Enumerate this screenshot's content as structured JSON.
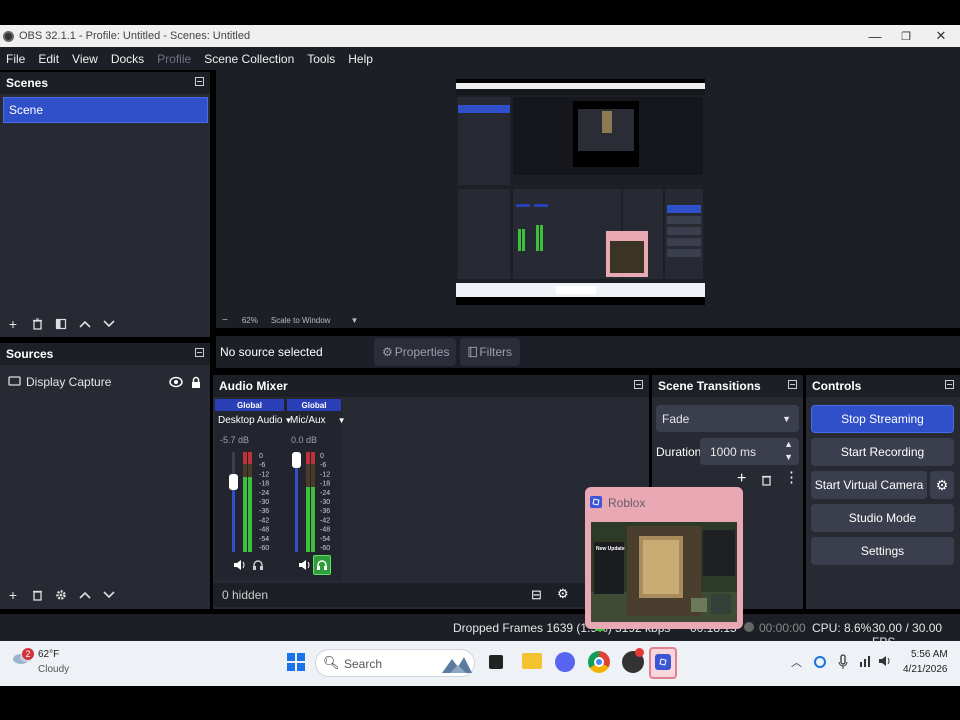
{
  "window": {
    "title": "OBS 32.1.1 - Profile: Untitled - Scenes: Untitled",
    "minimize": "—",
    "restore": "❐",
    "close": "✕"
  },
  "menu": {
    "file": "File",
    "edit": "Edit",
    "view": "View",
    "docks": "Docks",
    "profile": "Profile",
    "scene_collection": "Scene Collection",
    "tools": "Tools",
    "help": "Help"
  },
  "preview": {
    "zoom_value": "62%",
    "scale_mode": "Scale to Window"
  },
  "scenes": {
    "title": "Scenes",
    "items": [
      {
        "label": "Scene"
      }
    ]
  },
  "sources": {
    "title": "Sources",
    "items": [
      {
        "label": "Display Capture"
      }
    ]
  },
  "context": {
    "no_source": "No source selected",
    "properties": "Properties",
    "filters": "Filters"
  },
  "mixer": {
    "title": "Audio Mixer",
    "channels": [
      {
        "badge": "Global",
        "name": "Desktop Audio",
        "db": "-5.7 dB",
        "volume": 0.7,
        "level": 0.75
      },
      {
        "badge": "Global",
        "name": "Mic/Aux",
        "db": "0.0 dB",
        "volume": 0.92,
        "level": 0.65
      }
    ],
    "scale": [
      "0",
      "-6",
      "-12",
      "-18",
      "-24",
      "-30",
      "-36",
      "-42",
      "-48",
      "-54",
      "-60"
    ],
    "hidden": "0 hidden"
  },
  "transitions": {
    "title": "Scene Transitions",
    "selected": "Fade",
    "duration_label": "Duration",
    "duration_value": "1000 ms"
  },
  "controls": {
    "title": "Controls",
    "stop_streaming": "Stop Streaming",
    "start_recording": "Start Recording",
    "start_virtual_camera": "Start Virtual Camera",
    "studio_mode": "Studio Mode",
    "settings": "Settings"
  },
  "status": {
    "dropped_frames": "Dropped Frames 1639 (1.9%)",
    "bitrate": "5192 kbps",
    "stream_time": "00:18:15",
    "rec_time": "00:00:00",
    "cpu": "CPU: 8.6%",
    "fps": "30.00 / 30.00 FPS"
  },
  "popup": {
    "title": "Roblox",
    "headline": "New Update"
  },
  "taskbar": {
    "weather_temp": "62°F",
    "weather_desc": "Cloudy",
    "weather_badge": "2",
    "search_placeholder": "Search",
    "time": "5:56 AM",
    "date": "4/21/2026"
  },
  "colors": {
    "accent": "#2f50c8",
    "dock_bg": "#272a33",
    "header_bg": "#1d1f26",
    "meter_green": "#3cbf3c",
    "meter_red": "#c0303a"
  }
}
